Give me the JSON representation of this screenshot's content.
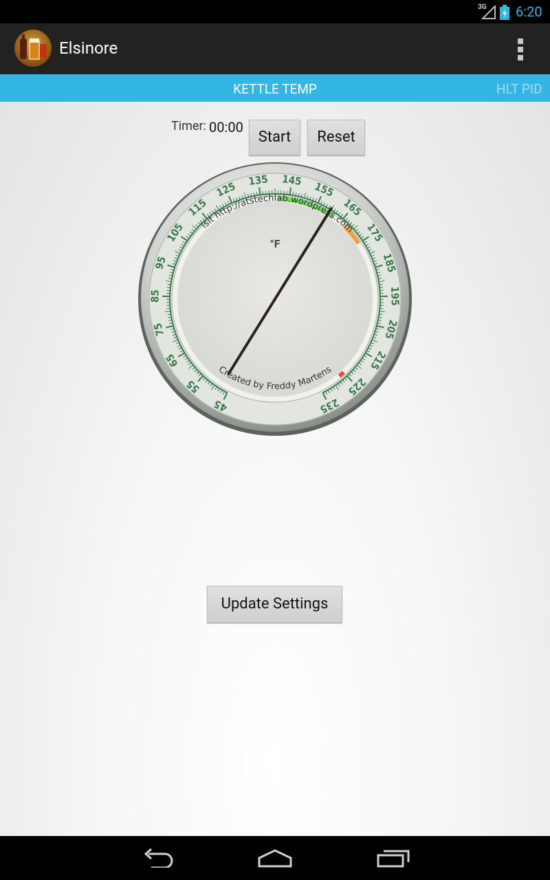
{
  "status_bar": {
    "network": "3G",
    "time": "6:20"
  },
  "app": {
    "title": "Elsinore"
  },
  "tabs": {
    "current": "KETTLE TEMP",
    "next": "HLT PID"
  },
  "timer": {
    "label": "Timer:",
    "value": "00:00"
  },
  "buttons": {
    "start": "Start",
    "reset": "Reset",
    "update": "Update Settings"
  },
  "gauge": {
    "unit": "°F",
    "top_text": "Visit http://atstechlab.wordpress.com",
    "bottom_text": "Created by Freddy Martens",
    "scale_labels": [
      "45",
      "55",
      "65",
      "75",
      "85",
      "95",
      "105",
      "115",
      "125",
      "135",
      "145",
      "155",
      "165",
      "175",
      "185",
      "195",
      "205",
      "215",
      "225",
      "235"
    ],
    "min": 45,
    "max": 235,
    "needle_value": 48,
    "ranges": [
      {
        "from": 141,
        "to": 162,
        "color": "#66dd55"
      },
      {
        "from": 167,
        "to": 175,
        "color": "#f0a040"
      },
      {
        "from": 225,
        "to": 227,
        "color": "#ee4444"
      }
    ],
    "tick_color": "#3a7a4a",
    "label_color": "#3a7a4a"
  },
  "colors": {
    "accent": "#33b5e5",
    "clock": "#33b5e5",
    "actionbar": "#222222"
  },
  "icons": {
    "app_logo": "beer-bottle-glass-icon",
    "overflow": "overflow-menu-icon",
    "back": "back-icon",
    "home": "home-icon",
    "recents": "recents-icon"
  }
}
